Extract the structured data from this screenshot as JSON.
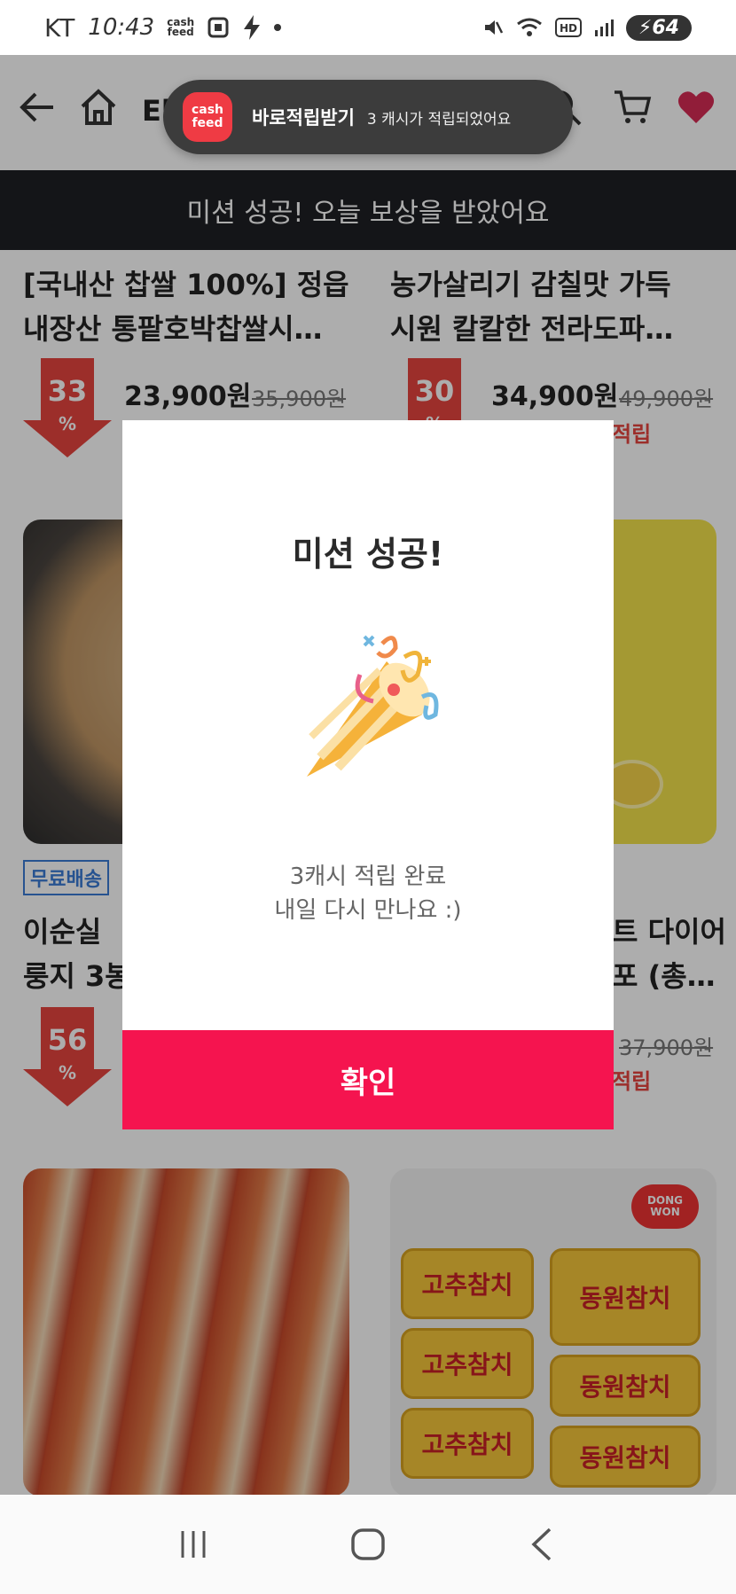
{
  "status_bar": {
    "carrier": "KT",
    "time": "10:43",
    "cashfeed_line1": "cash",
    "cashfeed_line2": "feed",
    "battery": "64"
  },
  "header": {
    "title_partial": "El",
    "icons": [
      "back-arrow-icon",
      "home-icon",
      "search-icon",
      "cart-icon",
      "heart-icon"
    ]
  },
  "toast": {
    "logo_line1": "cash",
    "logo_line2": "feed",
    "title": "바로적립받기",
    "message": "3 캐시가 적립되었어요"
  },
  "banner": {
    "text": "미션 성공! 오늘 보상을 받았어요"
  },
  "products": [
    {
      "name_line1": "[국내산 찹쌀 100%] 정읍",
      "name_line2": "내장산 통팥호박찹쌀시…",
      "discount": "33",
      "discount_unit": "%",
      "price": "23,900원",
      "orig_price": "35,900원"
    },
    {
      "name_line1": "농가살리기 감칠맛 가득",
      "name_line2": "시원 칼칼한 전라도파…",
      "discount": "30",
      "discount_unit": "%",
      "price": "34,900원",
      "orig_price": "49,900원",
      "reward": "적립"
    },
    {
      "badge": "무료배송",
      "name_line1": "이순실 ",
      "name_line2": "룽지 3봉",
      "discount": "56",
      "discount_unit": "%"
    },
    {
      "name_line1": "트 다이어",
      "name_line2": "포 (총…",
      "orig_price": "37,900원",
      "reward": "적립"
    }
  ],
  "tuna_labels": {
    "brand": "DONG WON",
    "can1": "고추참치",
    "can2": "동원참치"
  },
  "modal": {
    "title": "미션 성공!",
    "line1": "3캐시 적립 완료",
    "line2": "내일 다시 만나요 :)",
    "confirm": "확인"
  },
  "colors": {
    "confirm_button": "#f5144f",
    "discount_red": "#e6453f",
    "banner_bg": "#1e2024",
    "toast_logo": "#ef3b44"
  }
}
